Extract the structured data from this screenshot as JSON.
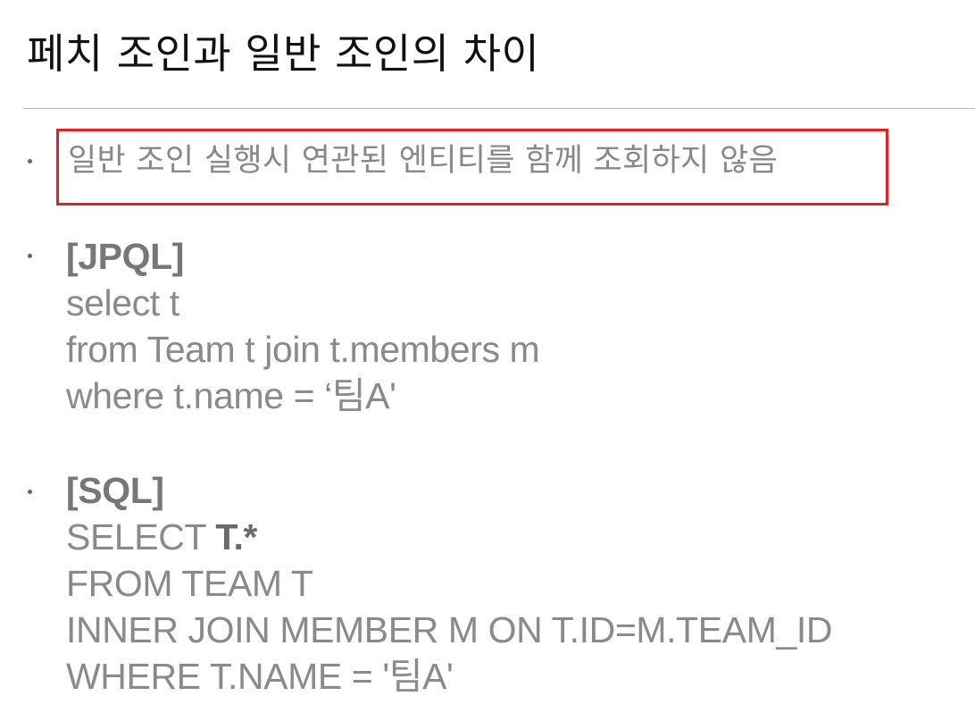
{
  "title": "페치 조인과 일반 조인의 차이",
  "note": "일반 조인 실행시 연관된 엔티티를 함께 조회하지 않음",
  "jpql": {
    "heading": "[JPQL]",
    "lines": [
      "select t",
      "from Team t join t.members m",
      "where t.name = ‘팀A'"
    ]
  },
  "sql": {
    "heading": "[SQL]",
    "select_keyword": "SELECT ",
    "select_columns": "T.*",
    "lines": [
      "FROM TEAM T",
      "INNER JOIN MEMBER M ON T.ID=M.TEAM_ID",
      "WHERE T.NAME = '팀A'"
    ]
  },
  "colors": {
    "highlight_border": "#e02227",
    "body_text": "#8a8a8a",
    "title_text": "#111111"
  }
}
